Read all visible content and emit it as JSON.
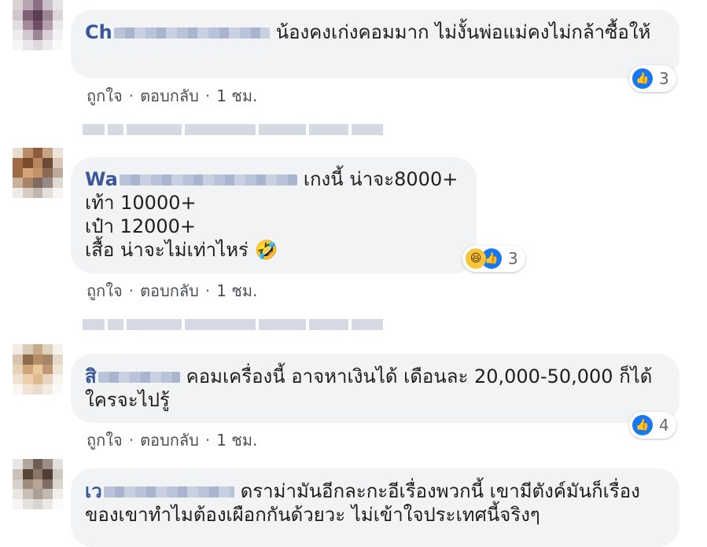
{
  "comments": [
    {
      "name_visible": "Ch",
      "text": "น้องคงเก่งคอมมาก ไม่งั้นพ่อแม่คงไม่กล้าซื้อให้",
      "reactions": {
        "types": [
          "like"
        ],
        "count": "3"
      },
      "actions": {
        "like": "ถูกใจ",
        "reply": "ตอบกลับ",
        "time": "1 ชม."
      }
    },
    {
      "name_visible": "Wa",
      "text_lines": [
        "เกงนี้ น่าจะ8000+",
        "เท้า 10000+",
        "เป๋า 12000+",
        "เสื้อ น่าจะไม่เท่าไหร่ 🤣"
      ],
      "reactions": {
        "types": [
          "haha",
          "like"
        ],
        "count": "3"
      },
      "actions": {
        "like": "ถูกใจ",
        "reply": "ตอบกลับ",
        "time": "1 ชม."
      }
    },
    {
      "name_visible": "สิ",
      "text": "คอมเครื่องนี้ อาจหาเงินได้ เดือนละ 20,000-50,000 ก็ได้ ใครจะไปรู้",
      "reactions": {
        "types": [
          "like"
        ],
        "count": "4"
      },
      "actions": {
        "like": "ถูกใจ",
        "reply": "ตอบกลับ",
        "time": "1 ชม."
      }
    },
    {
      "name_visible": "เว",
      "text": "ดราม่ามันอีกละกะอีเรื่องพวกนี้ เขามีตังค์มันก็เรื่องของเขาทำไมต้องเผือกกันด้วยวะ ไม่เข้าใจประเทศนี้จริงๆ"
    }
  ],
  "actions_separator": "·",
  "colors": {
    "name": "#385898",
    "bubble": "#f2f3f5",
    "like": "#1877f2",
    "meta": "#606770"
  },
  "icons": {
    "like": "like-icon",
    "haha": "haha-icon"
  }
}
